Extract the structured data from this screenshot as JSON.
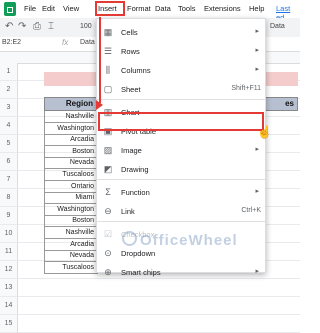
{
  "menubar": {
    "items": [
      "File",
      "Edit",
      "View",
      "Insert",
      "Format",
      "Data",
      "Tools",
      "Extensions",
      "Help"
    ],
    "last_edit": "Last ed"
  },
  "toolbar": {
    "zoom": "100",
    "font": "Data"
  },
  "formula_bar": {
    "name_box": "B2:E2",
    "fx": "fx",
    "content": "Data"
  },
  "sheet": {
    "row_numbers": [
      "1",
      "2",
      "3",
      "4",
      "5",
      "6",
      "7",
      "8",
      "9",
      "10",
      "11",
      "12",
      "13",
      "14",
      "15"
    ],
    "header_left": "Region",
    "header_right": "es",
    "regions": [
      "Nashville",
      "Washington",
      "Arcadia",
      "Boston",
      "Nevada",
      "Tuscaloos",
      "Ontario",
      "Miami",
      "Washington",
      "Boston",
      "Nashville",
      "Arcadia",
      "Nevada",
      "Tuscaloos"
    ]
  },
  "insert_menu": {
    "items": [
      {
        "icon": "cells-icon",
        "glyph": "▦",
        "label": "Cells",
        "shortcut": "",
        "submenu": true,
        "disabled": false
      },
      {
        "icon": "rows-icon",
        "glyph": "☰",
        "label": "Rows",
        "shortcut": "",
        "submenu": true,
        "disabled": false
      },
      {
        "icon": "columns-icon",
        "glyph": "⫼",
        "label": "Columns",
        "shortcut": "",
        "submenu": true,
        "disabled": false
      },
      {
        "icon": "sheet-icon",
        "glyph": "▢",
        "label": "Sheet",
        "shortcut": "Shift+F11",
        "submenu": false,
        "disabled": false
      },
      {
        "icon": "chart-icon",
        "glyph": "▥",
        "label": "Chart",
        "shortcut": "",
        "submenu": false,
        "disabled": false
      },
      {
        "icon": "pivot-table-icon",
        "glyph": "▣",
        "label": "Pivot table",
        "shortcut": "",
        "submenu": false,
        "disabled": false
      },
      {
        "icon": "image-icon",
        "glyph": "▨",
        "label": "Image",
        "shortcut": "",
        "submenu": true,
        "disabled": false
      },
      {
        "icon": "drawing-icon",
        "glyph": "◩",
        "label": "Drawing",
        "shortcut": "",
        "submenu": false,
        "disabled": false
      },
      {
        "icon": "function-icon",
        "glyph": "Σ",
        "label": "Function",
        "shortcut": "",
        "submenu": true,
        "disabled": false
      },
      {
        "icon": "link-icon",
        "glyph": "⊖",
        "label": "Link",
        "shortcut": "Ctrl+K",
        "submenu": false,
        "disabled": false
      },
      {
        "icon": "checkbox-icon",
        "glyph": "☑",
        "label": "Checkbox",
        "shortcut": "",
        "submenu": false,
        "disabled": true
      },
      {
        "icon": "dropdown-icon",
        "glyph": "⊙",
        "label": "Dropdown",
        "shortcut": "",
        "submenu": false,
        "disabled": false
      },
      {
        "icon": "smart-chips-icon",
        "glyph": "⊕",
        "label": "Smart chips",
        "shortcut": "",
        "submenu": true,
        "disabled": false
      }
    ]
  },
  "watermark": "OfficeWheel",
  "colors": {
    "highlight_red": "#e53935",
    "header_fill": "#b7c0d0",
    "title_fill": "#f4cccc"
  }
}
